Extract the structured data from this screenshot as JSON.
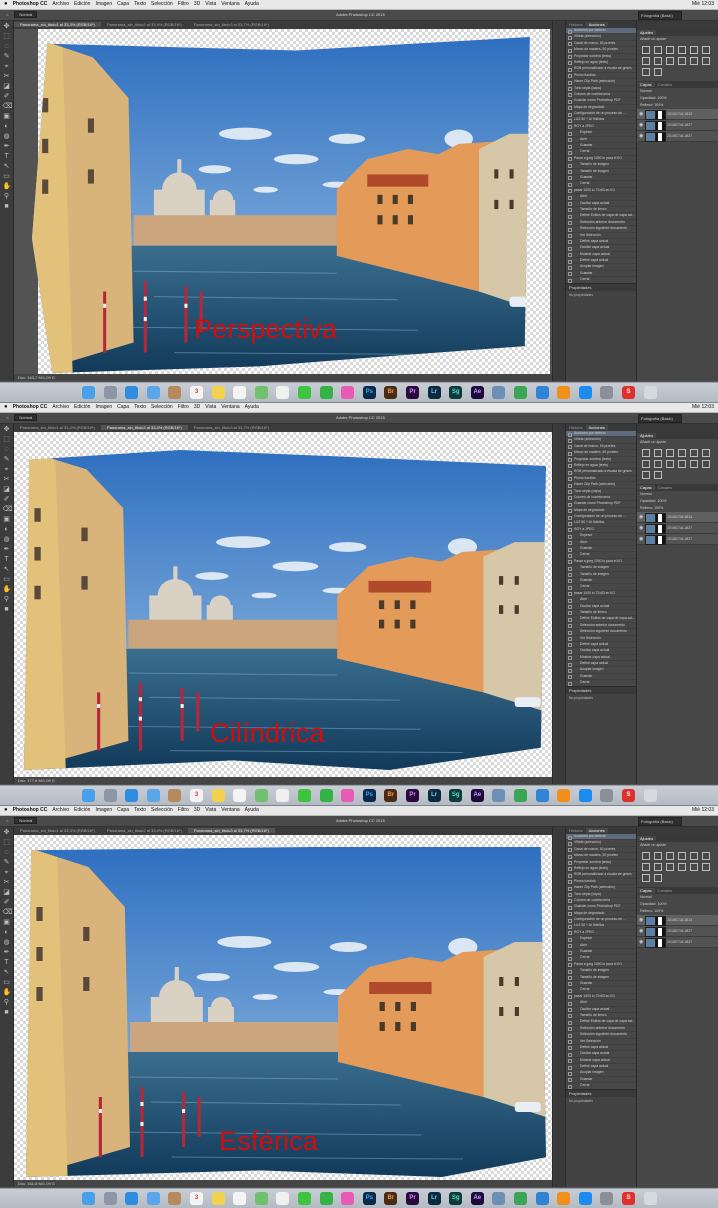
{
  "menubar": {
    "app_name": "Photoshop CC",
    "items": [
      "Archivo",
      "Edición",
      "Imagen",
      "Capa",
      "Texto",
      "Selección",
      "Filtro",
      "3D",
      "Vista",
      "Ventana",
      "Ayuda"
    ],
    "clock": "Mié 12:03"
  },
  "window_title": "Adobe Photoshop CC 2015",
  "options_bar": {
    "mode_label": "Normal",
    "workspace": "Fotografía (Basic)"
  },
  "screens": [
    {
      "projection": "Perspectiva",
      "tabs": [
        "Panorama_sin_titulo1 al 33,3% (RGB/16*)",
        "Panorama_sin_titulo2 al 33,4% (RGB/16*)",
        "Panorama_sin_titulo3 al 33,7% (RGB/16*)"
      ],
      "active_tab": 0,
      "status": "Doc: 163,7 M/1,09 G"
    },
    {
      "projection": "Cilíndrica",
      "tabs": [
        "Panorama_sin_titulo1 al 33,3% (RGB/16*)",
        "Panorama_sin_titulo2 al 33,4% (RGB/16*)",
        "Panorama_sin_titulo3 al 33,7% (RGB/16*)"
      ],
      "active_tab": 1,
      "status": "Doc: 177,6 M/1,09 G"
    },
    {
      "projection": "Esférica",
      "tabs": [
        "Panorama_sin_titulo1 al 33,3% (RGB/16*)",
        "Panorama_sin_titulo2 al 33,4% (RGB/16*)",
        "Panorama_sin_titulo3 al 33,7% (RGB/16*)"
      ],
      "active_tab": 2,
      "status": "Doc: 161,8 M/1,09 G"
    }
  ],
  "panels": {
    "left_tabs": [
      "Historia",
      "Acciones"
    ],
    "actions": [
      {
        "label": "Acciones por defecto",
        "level": 0
      },
      {
        "label": "Viñeta (selección)",
        "level": 0
      },
      {
        "label": "Canal de marco, 50 píxeles",
        "level": 0
      },
      {
        "label": "Marco de madera, 50 píxeles",
        "level": 0
      },
      {
        "label": "Proyectar sombra (texto)",
        "level": 0
      },
      {
        "label": "Reflejo en agua (texto)",
        "level": 0
      },
      {
        "label": "RGB personalizado a escala de grises",
        "level": 0
      },
      {
        "label": "Plomo fundido",
        "level": 0
      },
      {
        "label": "Hacer Clip Path (selección)",
        "level": 0
      },
      {
        "label": "Tono sepia (capa)",
        "level": 0
      },
      {
        "label": "Colores de cuatricromía",
        "level": 0
      },
      {
        "label": "Guardar como Photoshop PDF",
        "level": 0
      },
      {
        "label": "Mapa de degradado",
        "level": 0
      },
      {
        "label": "Configuración de un proceso de ...",
        "level": 0
      },
      {
        "label": "LUZ 50 + Al Hábitos",
        "level": 0
      },
      {
        "label": "RGY a JPEG",
        "level": 0
      },
      {
        "label": "Espesor",
        "level": 1
      },
      {
        "label": "Abrir",
        "level": 1
      },
      {
        "label": "Guardar",
        "level": 1
      },
      {
        "label": "Cerrar",
        "level": 1
      },
      {
        "label": "Pasar a jpeg 1000 lo para el IIO",
        "level": 0
      },
      {
        "label": "Tamaño de imagen",
        "level": 1
      },
      {
        "label": "Tamaño de imagen",
        "level": 1
      },
      {
        "label": "Guardar",
        "level": 1
      },
      {
        "label": "Cerrar",
        "level": 1
      },
      {
        "label": "pasar 1000 lo 72x63 en IIO",
        "level": 0
      },
      {
        "label": "Abrir",
        "level": 1
      },
      {
        "label": "Ocultar capa actual",
        "level": 1
      },
      {
        "label": "Tamaño de lienzo",
        "level": 1
      },
      {
        "label": "Definir Estilos de capa de capa act...",
        "level": 1
      },
      {
        "label": "Selección anterior documento",
        "level": 1
      },
      {
        "label": "Selección siguiente documento",
        "level": 1
      },
      {
        "label": "Ver Selección",
        "level": 1
      },
      {
        "label": "Definir capa actual",
        "level": 1
      },
      {
        "label": "Ocultar capa actual",
        "level": 1
      },
      {
        "label": "Mostrar capa actual",
        "level": 1
      },
      {
        "label": "Definir capa actual",
        "level": 1
      },
      {
        "label": "Acoplar imagen",
        "level": 1
      },
      {
        "label": "Guardar",
        "level": 1
      },
      {
        "label": "Cerrar",
        "level": 1
      }
    ],
    "properties_title": "Propiedades",
    "properties_text": "No propiedades",
    "right_tabs_top": [
      "Ajustes"
    ],
    "adjust_label": "Añadir un ajuste",
    "right_tabs_layers": [
      "Capas",
      "Canales"
    ],
    "blend_mode": "Normal",
    "opacity": "Opacidad: 100%",
    "fill": "Relleno: 100%",
    "layers": [
      "20150718-1813",
      "20150718-1827",
      "20150718-1837"
    ]
  },
  "dock": [
    "finder",
    "launchpad",
    "safari",
    "mail",
    "contacts",
    "calendar",
    "notes",
    "reminders",
    "maps",
    "photos",
    "messages",
    "facetime",
    "itunes",
    "ps",
    "br",
    "pr",
    "lr",
    "sg",
    "ae",
    "preview",
    "numbers",
    "keynote",
    "ibooks",
    "appstore",
    "prefs",
    "s",
    "trash"
  ]
}
